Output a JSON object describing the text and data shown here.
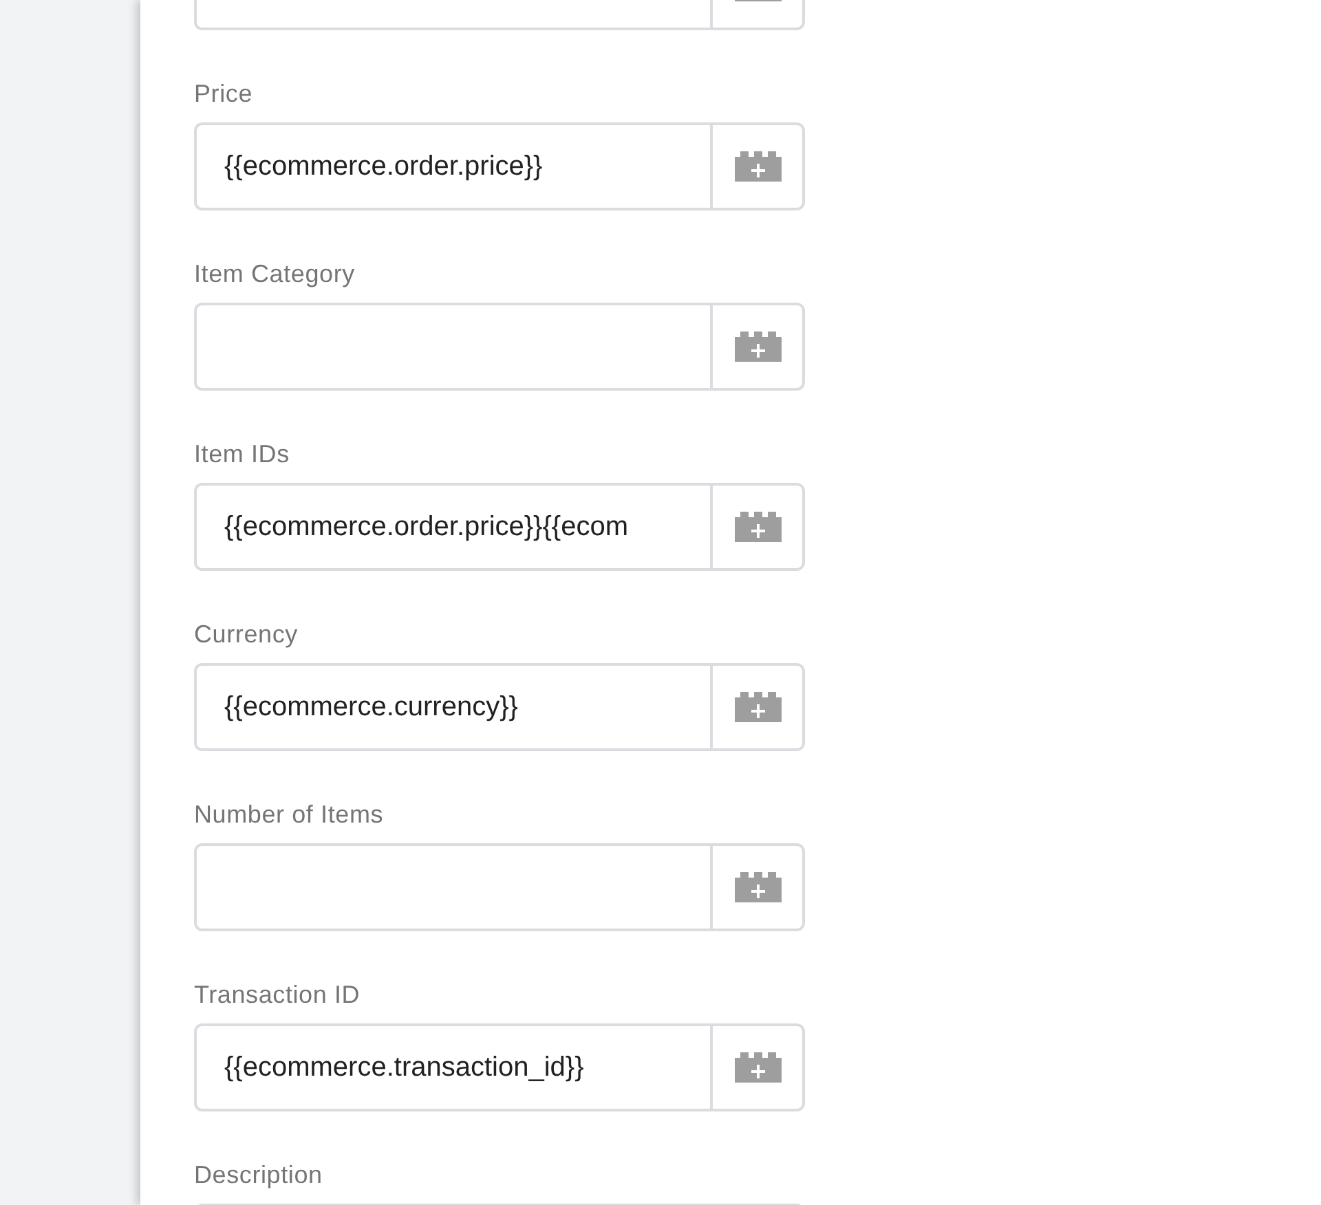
{
  "fields": [
    {
      "label": "Price",
      "value": "{{ecommerce.order.price}}"
    },
    {
      "label": "Item Category"
    },
    {
      "label": "Item IDs",
      "value": "{{ecommerce.order.price}}{{ecom"
    },
    {
      "label": "Currency",
      "value": "{{ecommerce.currency}}"
    },
    {
      "label": "Number of Items"
    },
    {
      "label": "Transaction ID",
      "value": "{{ecommerce.transaction_id}}"
    },
    {
      "label": "Description"
    }
  ]
}
